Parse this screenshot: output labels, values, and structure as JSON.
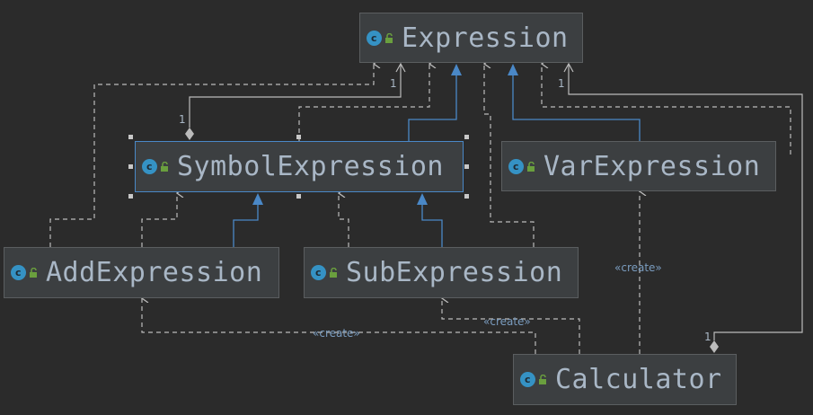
{
  "colors": {
    "background": "#2b2b2b",
    "node_fill": "#3c3f41",
    "node_border": "#5b5e60",
    "selection_border": "#4a88c7",
    "text": "#a9b7c6",
    "edge_gray": "#bbbbbb",
    "inheritance_blue": "#4a88c7",
    "class_icon": "#3592c4",
    "lock_icon": "#6a9f3e"
  },
  "icons": {
    "class": "class-c-icon",
    "visibility": "unlocked-lock-icon"
  },
  "class_icon_letter": "c",
  "nodes": {
    "expression": {
      "name": "Expression"
    },
    "symbol_expression": {
      "name": "SymbolExpression",
      "selected": true
    },
    "var_expression": {
      "name": "VarExpression"
    },
    "add_expression": {
      "name": "AddExpression"
    },
    "sub_expression": {
      "name": "SubExpression"
    },
    "calculator": {
      "name": "Calculator"
    }
  },
  "labels": {
    "create_var": "«create»",
    "create_add": "«create»",
    "create_sub": "«create»"
  },
  "multiplicities": {
    "symbol_to_expression": "1",
    "expression_to_symbol": "1",
    "expression_to_calculator": "1",
    "calculator_to_expression": "1"
  },
  "relations": [
    {
      "from": "SymbolExpression",
      "to": "Expression",
      "kind": "inheritance"
    },
    {
      "from": "VarExpression",
      "to": "Expression",
      "kind": "inheritance"
    },
    {
      "from": "AddExpression",
      "to": "SymbolExpression",
      "kind": "inheritance"
    },
    {
      "from": "SubExpression",
      "to": "SymbolExpression",
      "kind": "inheritance"
    },
    {
      "from": "SymbolExpression",
      "to": "Expression",
      "kind": "composition"
    },
    {
      "from": "Calculator",
      "to": "Expression",
      "kind": "composition"
    },
    {
      "from": "SymbolExpression",
      "to": "Expression",
      "kind": "dependency"
    },
    {
      "from": "AddExpression",
      "to": "Expression",
      "kind": "dependency"
    },
    {
      "from": "AddExpression",
      "to": "SymbolExpression",
      "kind": "dependency"
    },
    {
      "from": "SubExpression",
      "to": "Expression",
      "kind": "dependency"
    },
    {
      "from": "SubExpression",
      "to": "SymbolExpression",
      "kind": "dependency"
    },
    {
      "from": "VarExpression",
      "to": "Expression",
      "kind": "dependency"
    },
    {
      "from": "Calculator",
      "to": "VarExpression",
      "kind": "create"
    },
    {
      "from": "Calculator",
      "to": "AddExpression",
      "kind": "create"
    },
    {
      "from": "Calculator",
      "to": "SubExpression",
      "kind": "create"
    }
  ]
}
